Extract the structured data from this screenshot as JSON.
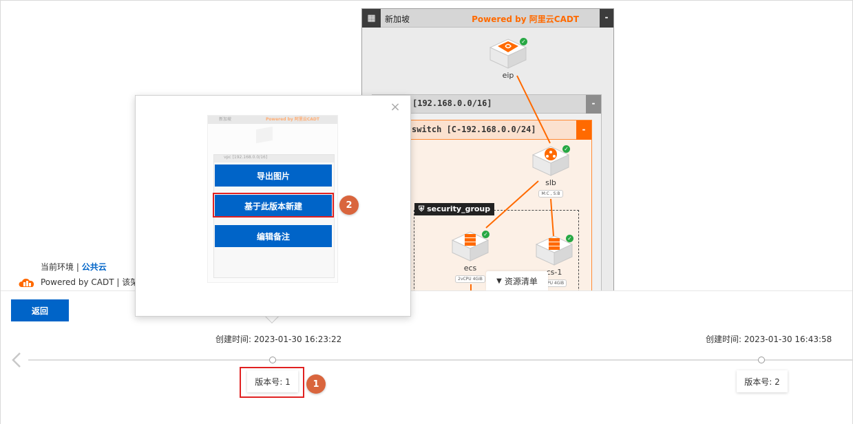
{
  "diagram": {
    "region_name": "新加坡",
    "powered_by": "Powered by 阿里云CADT",
    "collapse_label": "-",
    "vpc_label": "[192.168.0.0/16]",
    "vswitch_label": "switch [C-192.168.0.0/24]",
    "security_group_label": "security_group",
    "nodes": {
      "eip": {
        "name": "eip"
      },
      "slb": {
        "name": "slb",
        "spec": "M:C , S:B"
      },
      "ecs": {
        "name": "ecs",
        "spec": "2vCPU  4GiB"
      },
      "ecs1": {
        "name": "cs-1",
        "spec": "CPU  4GiB"
      }
    },
    "colors": {
      "link": "#ff6a00",
      "accent": "#ff6a00",
      "ok": "#27a844"
    }
  },
  "env": {
    "label": "当前环境 | ",
    "value": "公共云"
  },
  "powered_footer": "Powered by CADT | 该架构",
  "resource_tab": {
    "label": "资源清单",
    "caret_icon": "caret-down-icon"
  },
  "popup": {
    "close_icon": "close-icon",
    "export_label": "导出图片",
    "new_from_version_label": "基于此版本新建",
    "edit_note_label": "编辑备注",
    "thumb": {
      "region_name": "新加坡",
      "powered_by": "Powered by 阿里云CADT",
      "vpc_label": "vpc [192.168.0.0/16]"
    }
  },
  "bottom": {
    "back_label": "返回",
    "versions": [
      {
        "created": "创建时间: 2023-01-30 16:23:22",
        "version": "版本号: 1"
      },
      {
        "created": "创建时间: 2023-01-30 16:43:58",
        "version": "版本号: 2"
      }
    ]
  },
  "steps": [
    "1",
    "2"
  ],
  "colors": {
    "primary": "#0064c8",
    "highlight": "#e02020",
    "badge": "#d9653d"
  }
}
